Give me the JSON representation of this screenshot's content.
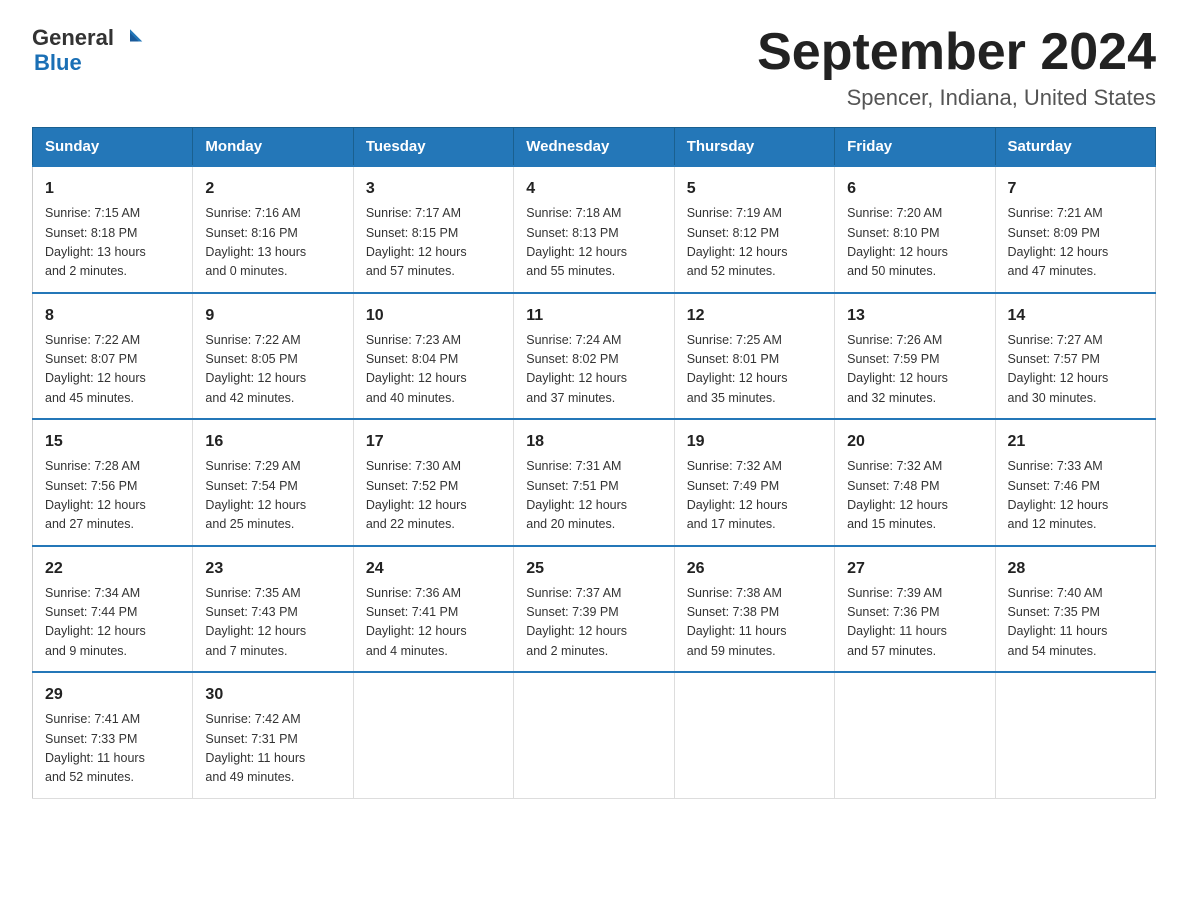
{
  "header": {
    "logo_general": "General",
    "logo_blue": "Blue",
    "title": "September 2024",
    "location": "Spencer, Indiana, United States"
  },
  "days_of_week": [
    "Sunday",
    "Monday",
    "Tuesday",
    "Wednesday",
    "Thursday",
    "Friday",
    "Saturday"
  ],
  "weeks": [
    [
      {
        "day": "1",
        "sunrise": "7:15 AM",
        "sunset": "8:18 PM",
        "daylight": "13 hours and 2 minutes."
      },
      {
        "day": "2",
        "sunrise": "7:16 AM",
        "sunset": "8:16 PM",
        "daylight": "13 hours and 0 minutes."
      },
      {
        "day": "3",
        "sunrise": "7:17 AM",
        "sunset": "8:15 PM",
        "daylight": "12 hours and 57 minutes."
      },
      {
        "day": "4",
        "sunrise": "7:18 AM",
        "sunset": "8:13 PM",
        "daylight": "12 hours and 55 minutes."
      },
      {
        "day": "5",
        "sunrise": "7:19 AM",
        "sunset": "8:12 PM",
        "daylight": "12 hours and 52 minutes."
      },
      {
        "day": "6",
        "sunrise": "7:20 AM",
        "sunset": "8:10 PM",
        "daylight": "12 hours and 50 minutes."
      },
      {
        "day": "7",
        "sunrise": "7:21 AM",
        "sunset": "8:09 PM",
        "daylight": "12 hours and 47 minutes."
      }
    ],
    [
      {
        "day": "8",
        "sunrise": "7:22 AM",
        "sunset": "8:07 PM",
        "daylight": "12 hours and 45 minutes."
      },
      {
        "day": "9",
        "sunrise": "7:22 AM",
        "sunset": "8:05 PM",
        "daylight": "12 hours and 42 minutes."
      },
      {
        "day": "10",
        "sunrise": "7:23 AM",
        "sunset": "8:04 PM",
        "daylight": "12 hours and 40 minutes."
      },
      {
        "day": "11",
        "sunrise": "7:24 AM",
        "sunset": "8:02 PM",
        "daylight": "12 hours and 37 minutes."
      },
      {
        "day": "12",
        "sunrise": "7:25 AM",
        "sunset": "8:01 PM",
        "daylight": "12 hours and 35 minutes."
      },
      {
        "day": "13",
        "sunrise": "7:26 AM",
        "sunset": "7:59 PM",
        "daylight": "12 hours and 32 minutes."
      },
      {
        "day": "14",
        "sunrise": "7:27 AM",
        "sunset": "7:57 PM",
        "daylight": "12 hours and 30 minutes."
      }
    ],
    [
      {
        "day": "15",
        "sunrise": "7:28 AM",
        "sunset": "7:56 PM",
        "daylight": "12 hours and 27 minutes."
      },
      {
        "day": "16",
        "sunrise": "7:29 AM",
        "sunset": "7:54 PM",
        "daylight": "12 hours and 25 minutes."
      },
      {
        "day": "17",
        "sunrise": "7:30 AM",
        "sunset": "7:52 PM",
        "daylight": "12 hours and 22 minutes."
      },
      {
        "day": "18",
        "sunrise": "7:31 AM",
        "sunset": "7:51 PM",
        "daylight": "12 hours and 20 minutes."
      },
      {
        "day": "19",
        "sunrise": "7:32 AM",
        "sunset": "7:49 PM",
        "daylight": "12 hours and 17 minutes."
      },
      {
        "day": "20",
        "sunrise": "7:32 AM",
        "sunset": "7:48 PM",
        "daylight": "12 hours and 15 minutes."
      },
      {
        "day": "21",
        "sunrise": "7:33 AM",
        "sunset": "7:46 PM",
        "daylight": "12 hours and 12 minutes."
      }
    ],
    [
      {
        "day": "22",
        "sunrise": "7:34 AM",
        "sunset": "7:44 PM",
        "daylight": "12 hours and 9 minutes."
      },
      {
        "day": "23",
        "sunrise": "7:35 AM",
        "sunset": "7:43 PM",
        "daylight": "12 hours and 7 minutes."
      },
      {
        "day": "24",
        "sunrise": "7:36 AM",
        "sunset": "7:41 PM",
        "daylight": "12 hours and 4 minutes."
      },
      {
        "day": "25",
        "sunrise": "7:37 AM",
        "sunset": "7:39 PM",
        "daylight": "12 hours and 2 minutes."
      },
      {
        "day": "26",
        "sunrise": "7:38 AM",
        "sunset": "7:38 PM",
        "daylight": "11 hours and 59 minutes."
      },
      {
        "day": "27",
        "sunrise": "7:39 AM",
        "sunset": "7:36 PM",
        "daylight": "11 hours and 57 minutes."
      },
      {
        "day": "28",
        "sunrise": "7:40 AM",
        "sunset": "7:35 PM",
        "daylight": "11 hours and 54 minutes."
      }
    ],
    [
      {
        "day": "29",
        "sunrise": "7:41 AM",
        "sunset": "7:33 PM",
        "daylight": "11 hours and 52 minutes."
      },
      {
        "day": "30",
        "sunrise": "7:42 AM",
        "sunset": "7:31 PM",
        "daylight": "11 hours and 49 minutes."
      },
      null,
      null,
      null,
      null,
      null
    ]
  ],
  "labels": {
    "sunrise": "Sunrise:",
    "sunset": "Sunset:",
    "daylight": "Daylight:"
  }
}
